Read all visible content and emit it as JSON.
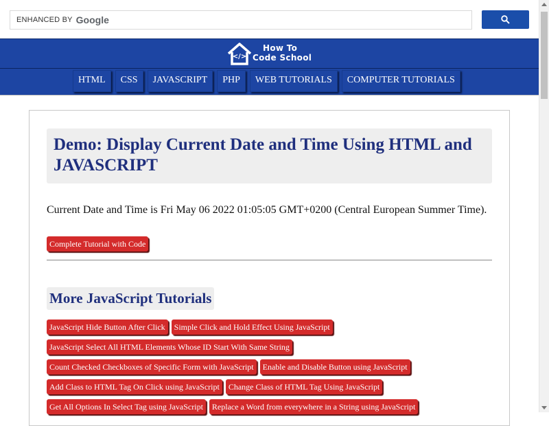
{
  "search": {
    "enhanced_label": "ENHANCED BY",
    "google_label": "Google",
    "value": "",
    "button_icon": "search-icon"
  },
  "header": {
    "logo_line1": "How To",
    "logo_line2": "Code School",
    "logo_icon": "house-code-icon"
  },
  "nav": {
    "items": [
      {
        "label": "HTML"
      },
      {
        "label": "CSS"
      },
      {
        "label": "JAVASCRIPT"
      },
      {
        "label": "PHP"
      },
      {
        "label": "WEB TUTORIALS"
      },
      {
        "label": "COMPUTER TUTORIALS"
      }
    ]
  },
  "main": {
    "title": "Demo: Display Current Date and Time Using HTML and JAVASCRIPT",
    "date_text": "Current Date and Time is Fri May 06 2022 01:05:05 GMT+0200 (Central European Summer Time).",
    "tutorial_button": "Complete Tutorial with Code",
    "more_title": "More JavaScript Tutorials",
    "links": [
      [
        "JavaScript Hide Button After Click",
        "Simple Click and Hold Effect Using JavaScript"
      ],
      [
        "JavaScript Select All HTML Elements Whose ID Start With Same String"
      ],
      [
        "Count Checked Checkboxes of Specific Form with JavaScript",
        "Enable and Disable Button using JavaScript"
      ],
      [
        "Add Class to HTML Tag On Click using JavaScript",
        "Change Class of HTML Tag Using JavaScript"
      ],
      [
        "Get All Options In Select Tag using JavaScript",
        "Replace a Word from everywhere in a String using JavaScript"
      ]
    ]
  },
  "colors": {
    "header_blue": "#1d45a3",
    "title_navy": "#1f2f7d",
    "button_red": "#d42b2b",
    "search_button_blue": "#1a4eaa"
  }
}
